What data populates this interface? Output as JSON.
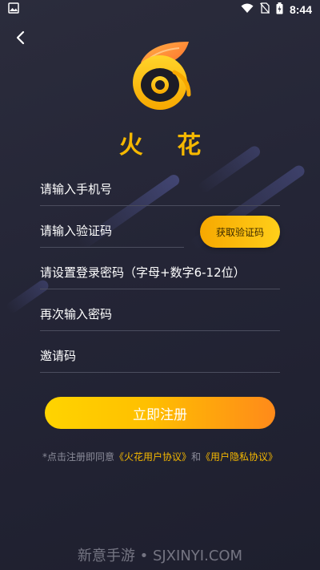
{
  "status_bar": {
    "time": "8:44",
    "icons": [
      "image-icon",
      "wifi-icon",
      "no-sim-icon",
      "battery-icon"
    ]
  },
  "header": {
    "back_icon": "back-arrow-icon"
  },
  "app": {
    "name": "火 花",
    "logo_icon": "flame-eye-logo",
    "accent_color": "#f5b800"
  },
  "form": {
    "phone_placeholder": "请输入手机号",
    "code_placeholder": "请输入验证码",
    "get_code_label": "获取验证码",
    "password_placeholder": "请设置登录密码（字母+数字6-12位）",
    "confirm_password_placeholder": "再次输入密码",
    "invite_code_placeholder": "邀请码",
    "register_label": "立即注册"
  },
  "agreement": {
    "prefix": "*点击注册即同意",
    "link1": "《火花用户协议》",
    "middle": "和",
    "link2": "《用户隐私协议》"
  },
  "watermark": "新意手游 • SJXINYI.COM"
}
